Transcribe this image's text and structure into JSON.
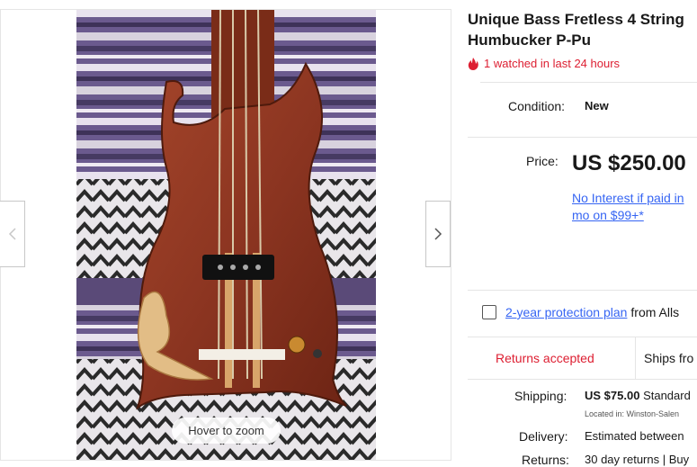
{
  "gallery": {
    "zoom_hint": "Hover to zoom",
    "photo_description_icon": "bass-guitar-photo"
  },
  "listing": {
    "title_line1": "Unique Bass Fretless 4 String",
    "title_line2": "Humbucker P-Pu",
    "watch_text": "1 watched in last 24 hours",
    "condition_label": "Condition:",
    "condition_value": "New",
    "price_label": "Price:",
    "price_value": "US $250.00",
    "finance_line1": "No Interest if paid in",
    "finance_line2": "mo on $99+*",
    "protection_link": "2-year protection plan",
    "protection_suffix": "from Alls",
    "returns_badge": "Returns accepted",
    "ships_badge": "Ships fro",
    "shipping_label": "Shipping:",
    "shipping_value": "US $75.00",
    "shipping_method": "Standard",
    "located_in": "Located in: Winston-Salen",
    "delivery_label": "Delivery:",
    "delivery_value": "Estimated between",
    "returns_label": "Returns:",
    "returns_value": "30 day returns | Buy"
  },
  "colors": {
    "accent_red": "#dd1e31",
    "link_blue": "#3665f3"
  }
}
